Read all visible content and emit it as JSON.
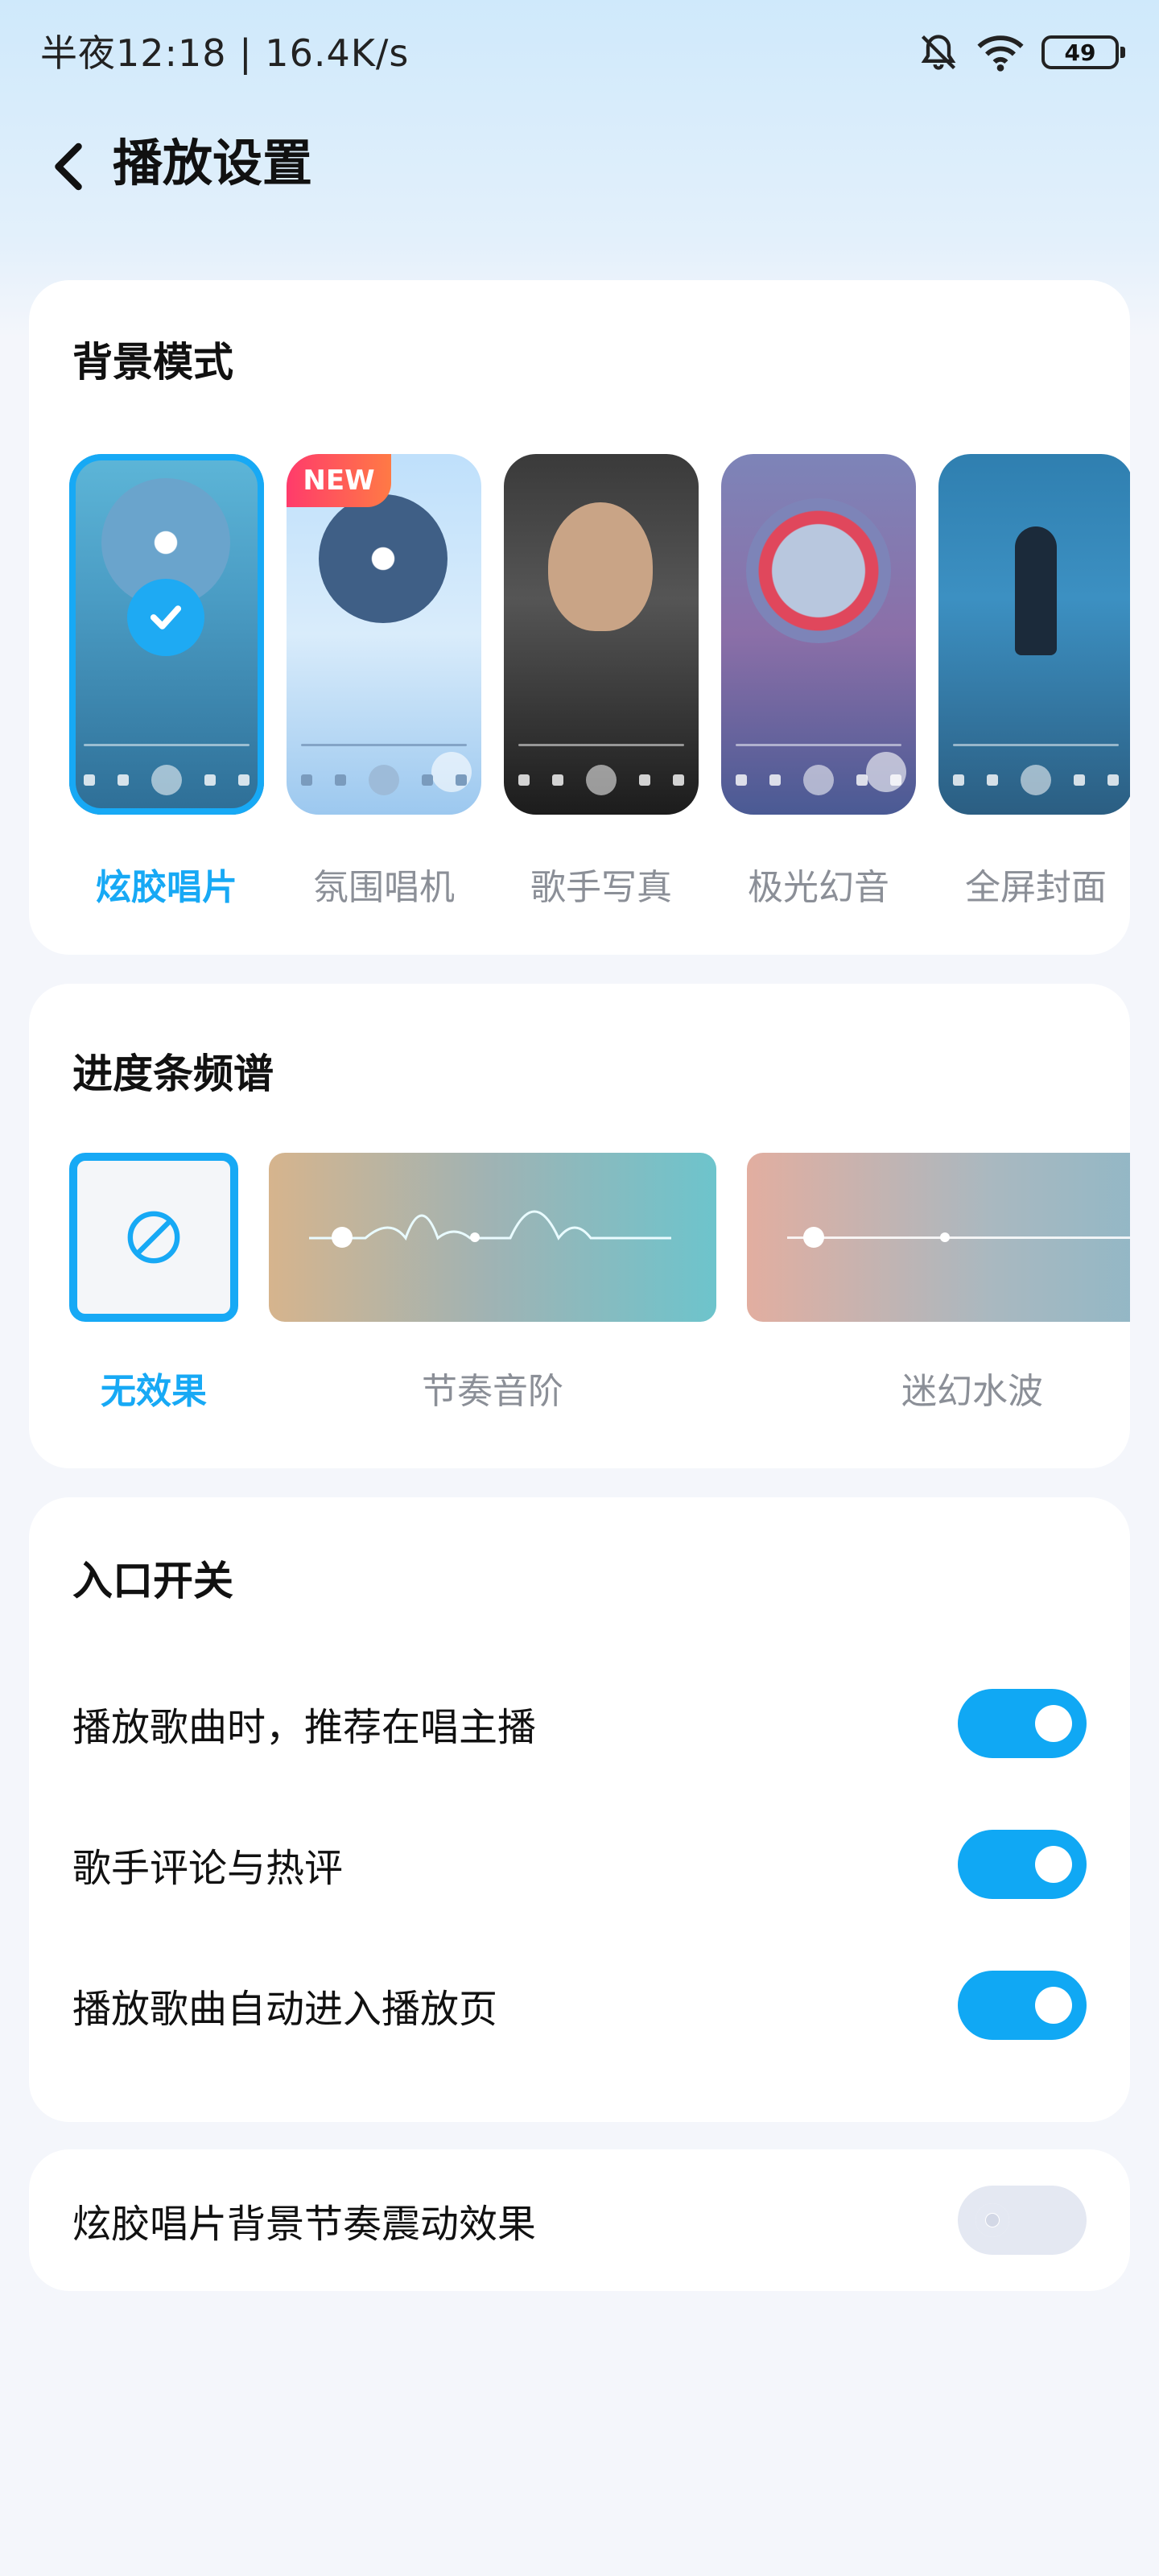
{
  "status_bar": {
    "time_speed": "半夜12:18 | 16.4K/s",
    "battery": "49"
  },
  "header": {
    "title": "播放设置"
  },
  "background_mode": {
    "title": "背景模式",
    "new_badge": "NEW",
    "items": [
      {
        "label": "炫胶唱片",
        "selected": true
      },
      {
        "label": "氛围唱机",
        "selected": false
      },
      {
        "label": "歌手写真",
        "selected": false
      },
      {
        "label": "极光幻音",
        "selected": false
      },
      {
        "label": "全屏封面",
        "selected": false
      }
    ]
  },
  "progress_spectrum": {
    "title": "进度条频谱",
    "items": [
      {
        "label": "无效果",
        "selected": true
      },
      {
        "label": "节奏音阶",
        "selected": false
      },
      {
        "label": "迷幻水波",
        "selected": false
      }
    ]
  },
  "entry_switches": {
    "title": "入口开关",
    "items": [
      {
        "label": "播放歌曲时，推荐在唱主播",
        "on": true
      },
      {
        "label": "歌手评论与热评",
        "on": true
      },
      {
        "label": "播放歌曲自动进入播放页",
        "on": true
      }
    ]
  },
  "vibration": {
    "label": "炫胶唱片背景节奏震动效果",
    "on": false
  },
  "colors": {
    "accent": "#17a9f5",
    "toggle_on": "#10a8f4",
    "toggle_off": "#e4e8f2",
    "label_muted": "#8b8f97"
  }
}
